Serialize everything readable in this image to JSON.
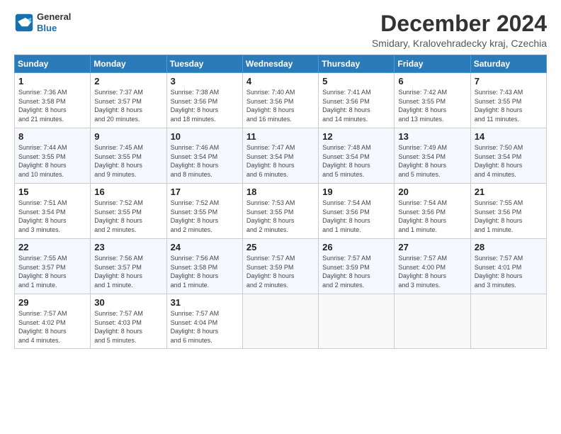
{
  "header": {
    "logo_line1": "General",
    "logo_line2": "Blue",
    "title": "December 2024",
    "subtitle": "Smidary, Kralovehradecky kraj, Czechia"
  },
  "columns": [
    "Sunday",
    "Monday",
    "Tuesday",
    "Wednesday",
    "Thursday",
    "Friday",
    "Saturday"
  ],
  "weeks": [
    [
      {
        "day": "1",
        "info": "Sunrise: 7:36 AM\nSunset: 3:58 PM\nDaylight: 8 hours\nand 21 minutes."
      },
      {
        "day": "2",
        "info": "Sunrise: 7:37 AM\nSunset: 3:57 PM\nDaylight: 8 hours\nand 20 minutes."
      },
      {
        "day": "3",
        "info": "Sunrise: 7:38 AM\nSunset: 3:56 PM\nDaylight: 8 hours\nand 18 minutes."
      },
      {
        "day": "4",
        "info": "Sunrise: 7:40 AM\nSunset: 3:56 PM\nDaylight: 8 hours\nand 16 minutes."
      },
      {
        "day": "5",
        "info": "Sunrise: 7:41 AM\nSunset: 3:56 PM\nDaylight: 8 hours\nand 14 minutes."
      },
      {
        "day": "6",
        "info": "Sunrise: 7:42 AM\nSunset: 3:55 PM\nDaylight: 8 hours\nand 13 minutes."
      },
      {
        "day": "7",
        "info": "Sunrise: 7:43 AM\nSunset: 3:55 PM\nDaylight: 8 hours\nand 11 minutes."
      }
    ],
    [
      {
        "day": "8",
        "info": "Sunrise: 7:44 AM\nSunset: 3:55 PM\nDaylight: 8 hours\nand 10 minutes."
      },
      {
        "day": "9",
        "info": "Sunrise: 7:45 AM\nSunset: 3:55 PM\nDaylight: 8 hours\nand 9 minutes."
      },
      {
        "day": "10",
        "info": "Sunrise: 7:46 AM\nSunset: 3:54 PM\nDaylight: 8 hours\nand 8 minutes."
      },
      {
        "day": "11",
        "info": "Sunrise: 7:47 AM\nSunset: 3:54 PM\nDaylight: 8 hours\nand 6 minutes."
      },
      {
        "day": "12",
        "info": "Sunrise: 7:48 AM\nSunset: 3:54 PM\nDaylight: 8 hours\nand 5 minutes."
      },
      {
        "day": "13",
        "info": "Sunrise: 7:49 AM\nSunset: 3:54 PM\nDaylight: 8 hours\nand 5 minutes."
      },
      {
        "day": "14",
        "info": "Sunrise: 7:50 AM\nSunset: 3:54 PM\nDaylight: 8 hours\nand 4 minutes."
      }
    ],
    [
      {
        "day": "15",
        "info": "Sunrise: 7:51 AM\nSunset: 3:54 PM\nDaylight: 8 hours\nand 3 minutes."
      },
      {
        "day": "16",
        "info": "Sunrise: 7:52 AM\nSunset: 3:55 PM\nDaylight: 8 hours\nand 2 minutes."
      },
      {
        "day": "17",
        "info": "Sunrise: 7:52 AM\nSunset: 3:55 PM\nDaylight: 8 hours\nand 2 minutes."
      },
      {
        "day": "18",
        "info": "Sunrise: 7:53 AM\nSunset: 3:55 PM\nDaylight: 8 hours\nand 2 minutes."
      },
      {
        "day": "19",
        "info": "Sunrise: 7:54 AM\nSunset: 3:56 PM\nDaylight: 8 hours\nand 1 minute."
      },
      {
        "day": "20",
        "info": "Sunrise: 7:54 AM\nSunset: 3:56 PM\nDaylight: 8 hours\nand 1 minute."
      },
      {
        "day": "21",
        "info": "Sunrise: 7:55 AM\nSunset: 3:56 PM\nDaylight: 8 hours\nand 1 minute."
      }
    ],
    [
      {
        "day": "22",
        "info": "Sunrise: 7:55 AM\nSunset: 3:57 PM\nDaylight: 8 hours\nand 1 minute."
      },
      {
        "day": "23",
        "info": "Sunrise: 7:56 AM\nSunset: 3:57 PM\nDaylight: 8 hours\nand 1 minute."
      },
      {
        "day": "24",
        "info": "Sunrise: 7:56 AM\nSunset: 3:58 PM\nDaylight: 8 hours\nand 1 minute."
      },
      {
        "day": "25",
        "info": "Sunrise: 7:57 AM\nSunset: 3:59 PM\nDaylight: 8 hours\nand 2 minutes."
      },
      {
        "day": "26",
        "info": "Sunrise: 7:57 AM\nSunset: 3:59 PM\nDaylight: 8 hours\nand 2 minutes."
      },
      {
        "day": "27",
        "info": "Sunrise: 7:57 AM\nSunset: 4:00 PM\nDaylight: 8 hours\nand 3 minutes."
      },
      {
        "day": "28",
        "info": "Sunrise: 7:57 AM\nSunset: 4:01 PM\nDaylight: 8 hours\nand 3 minutes."
      }
    ],
    [
      {
        "day": "29",
        "info": "Sunrise: 7:57 AM\nSunset: 4:02 PM\nDaylight: 8 hours\nand 4 minutes."
      },
      {
        "day": "30",
        "info": "Sunrise: 7:57 AM\nSunset: 4:03 PM\nDaylight: 8 hours\nand 5 minutes."
      },
      {
        "day": "31",
        "info": "Sunrise: 7:57 AM\nSunset: 4:04 PM\nDaylight: 8 hours\nand 6 minutes."
      },
      null,
      null,
      null,
      null
    ]
  ]
}
